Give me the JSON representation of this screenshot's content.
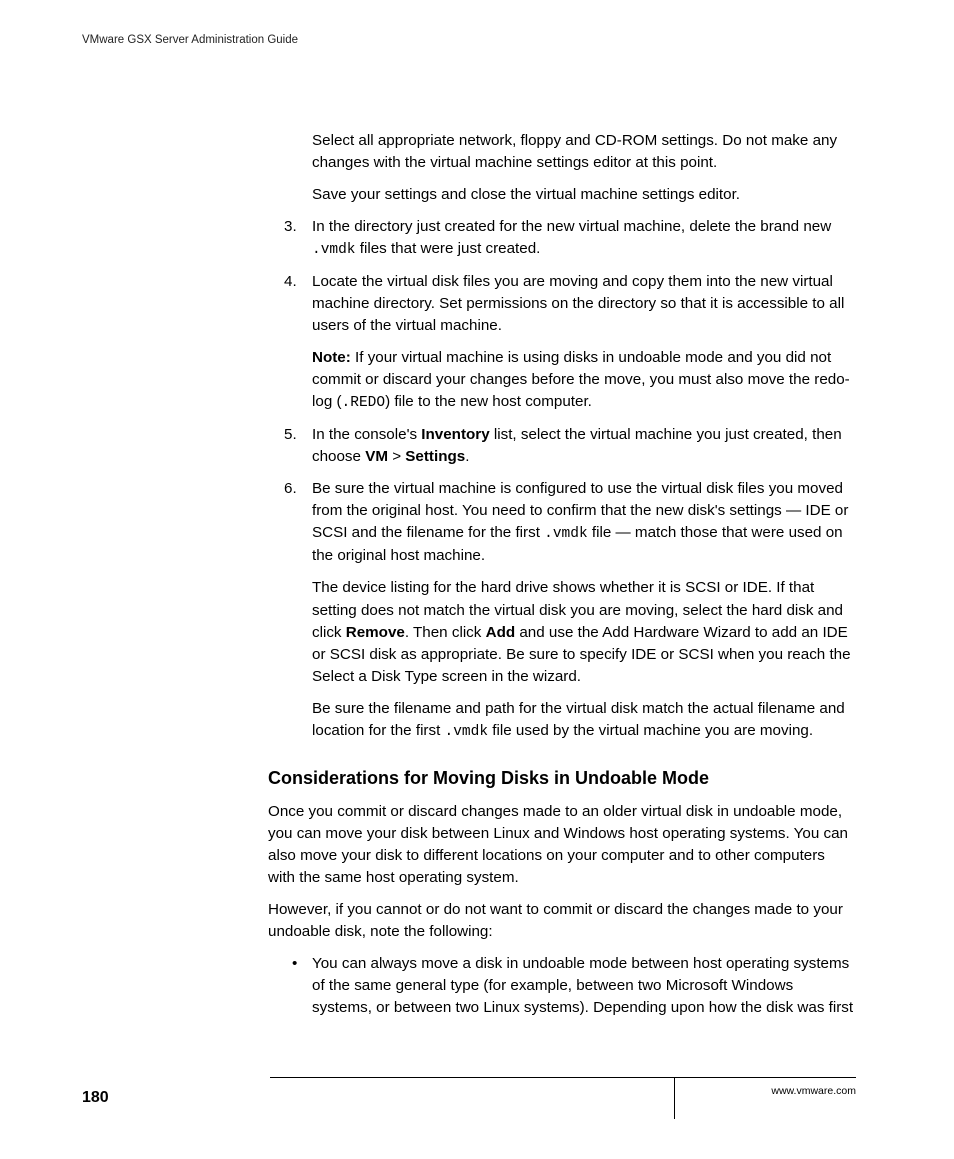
{
  "header": {
    "running_title": "VMware GSX Server Administration Guide"
  },
  "body": {
    "intro_p1": "Select all appropriate network, floppy and CD-ROM settings. Do not make any changes with the virtual machine settings editor at this point.",
    "intro_p2": "Save your settings and close the virtual machine settings editor.",
    "step3": {
      "num": "3.",
      "t1": "In the directory just created for the new virtual machine, delete the brand new ",
      "code1": ".vmdk",
      "t2": " files that were just created."
    },
    "step4": {
      "num": "4.",
      "p1": "Locate the virtual disk files you are moving and copy them into the new virtual machine directory. Set permissions on the directory so that it is accessible to all users of the virtual machine.",
      "note_label": "Note:",
      "note_t1": "  If your virtual machine is using disks in undoable mode and you did not commit or discard your changes before the move, you must also move the redo-log (",
      "note_code": ".REDO",
      "note_t2": ") file to the new host computer."
    },
    "step5": {
      "num": "5.",
      "t1": "In the console's ",
      "b1": "Inventory",
      "t2": " list, select the virtual machine you just created, then choose ",
      "b2": "VM",
      "t3": " > ",
      "b3": "Settings",
      "t4": "."
    },
    "step6": {
      "num": "6.",
      "p1_t1": "Be sure the virtual machine is configured to use the virtual disk files you moved from the original host. You need to confirm that the new disk's settings — IDE or SCSI and the filename for the first ",
      "p1_code": ".vmdk",
      "p1_t2": " file — match those that were used on the original host machine.",
      "p2_t1": "The device listing for the hard drive shows whether it is SCSI or IDE. If that setting does not match the virtual disk you are moving, select the hard disk and click ",
      "p2_b1": "Remove",
      "p2_t2": ". Then click ",
      "p2_b2": "Add",
      "p2_t3": " and use the Add Hardware Wizard to add an IDE or SCSI disk as appropriate. Be sure to specify IDE or SCSI when you reach the Select a Disk Type screen in the wizard.",
      "p3_t1": "Be sure the filename and path for the virtual disk match the actual filename and location for the first ",
      "p3_code": ".vmdk",
      "p3_t2": " file used by the virtual machine you are moving."
    },
    "section_heading": "Considerations for Moving Disks in Undoable Mode",
    "sec_p1": "Once you commit or discard changes made to an older virtual disk in undoable mode, you can move your disk between Linux and Windows host operating systems. You can also move your disk to different locations on your computer and to other computers with the same host operating system.",
    "sec_p2": "However, if you cannot or do not want to commit or discard the changes made to your undoable disk, note the following:",
    "bullet1": "You can always move a disk in undoable mode between host operating systems of the same general type (for example, between two Microsoft Windows systems, or between two Linux systems). Depending upon how the disk was first"
  },
  "footer": {
    "page_number": "180",
    "url": "www.vmware.com"
  }
}
